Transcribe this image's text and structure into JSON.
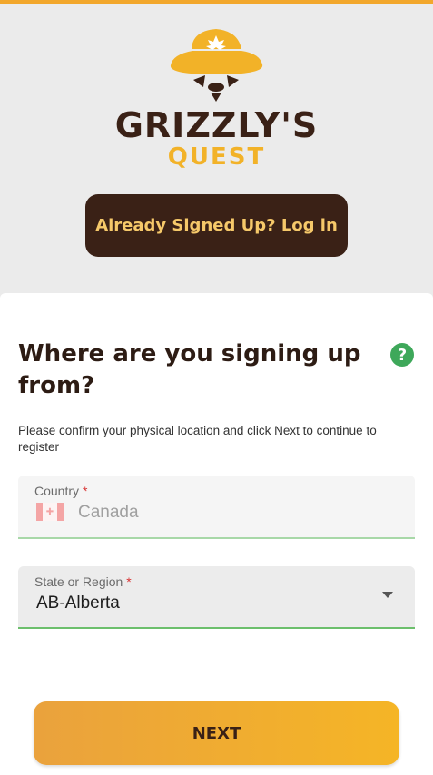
{
  "brand": {
    "name_top": "GRIZZLY'S",
    "name_bottom": "QUEST",
    "primary_color": "#3a2116",
    "accent_color": "#f2b228"
  },
  "header": {
    "login_button": "Already Signed Up? Log in"
  },
  "form": {
    "heading": "Where are you signing up from?",
    "help_icon": "?",
    "description": "Please confirm your physical location and click Next to continue to register",
    "country": {
      "label": "Country",
      "required_mark": "*",
      "value": "Canada",
      "flag_icon": "canada-flag-icon"
    },
    "region": {
      "label": "State or Region",
      "required_mark": "*",
      "value": "AB-Alberta"
    },
    "next_button": "NEXT"
  }
}
